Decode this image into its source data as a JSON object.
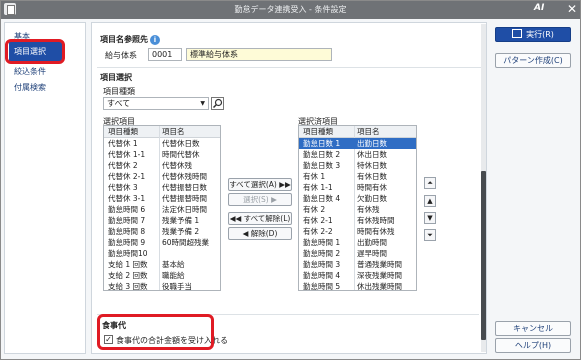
{
  "window": {
    "title": "勤怠データ連携受入 - 条件設定",
    "logo_text": "AI",
    "close_glyph": "✕"
  },
  "nav": {
    "items": [
      "基本",
      "項目選択",
      "絞込条件",
      "付属検索"
    ]
  },
  "ref": {
    "section_title": "項目名参照先",
    "info_glyph": "i",
    "label": "給与体系",
    "code": "0001",
    "name": "標準給与体系"
  },
  "itemsel": {
    "section_title": "項目選択",
    "type_label": "項目種類",
    "type_value": "すべて",
    "avail_label": "選択項目",
    "selected_label": "選択済項目",
    "col_type": "項目種類",
    "col_name": "項目名",
    "available": [
      [
        "代替休 1",
        "代替休日数"
      ],
      [
        "代替休 1-1",
        "時間代替休"
      ],
      [
        "代替休 2",
        "代替休残"
      ],
      [
        "代替休 2-1",
        "代替休残時間"
      ],
      [
        "代替休 3",
        "代替振替日数"
      ],
      [
        "代替休 3-1",
        "代替振替時間"
      ],
      [
        "勤怠時間 6",
        "法定休日時間"
      ],
      [
        "勤怠時間 7",
        "残業予備 1"
      ],
      [
        "勤怠時間 8",
        "残業予備 2"
      ],
      [
        "勤怠時間 9",
        "60時間超残業"
      ],
      [
        "勤怠時間10",
        ""
      ],
      [
        "支給 1 回数",
        "基本給"
      ],
      [
        "支給 2 回数",
        "職能給"
      ],
      [
        "支給 3 回数",
        "役職手当"
      ]
    ],
    "selected": [
      [
        "勤怠日数 1",
        "出勤日数"
      ],
      [
        "勤怠日数 2",
        "休出日数"
      ],
      [
        "勤怠日数 3",
        "特休日数"
      ],
      [
        "有休 1",
        "有休日数"
      ],
      [
        "有休 1-1",
        "時間有休"
      ],
      [
        "勤怠日数 4",
        "欠勤日数"
      ],
      [
        "有休 2",
        "有休残"
      ],
      [
        "有休 2-1",
        "有休残時間"
      ],
      [
        "有休 2-2",
        "時間有休残"
      ],
      [
        "勤怠時間 1",
        "出勤時間"
      ],
      [
        "勤怠時間 2",
        "遅早時間"
      ],
      [
        "勤怠時間 3",
        "普通残業時間"
      ],
      [
        "勤怠時間 4",
        "深夜残業時間"
      ],
      [
        "勤怠時間 5",
        "休出残業時間"
      ]
    ],
    "btn_select_all": "すべて選択(A) ▶▶",
    "btn_select": "選択(S) ▶",
    "btn_unselect_all": "◀◀ すべて解除(L)",
    "btn_unselect": "◀ 解除(D)",
    "order_glyphs": [
      "⏶",
      "▲",
      "▼",
      "⏷"
    ]
  },
  "meal": {
    "section_title": "食事代",
    "checkbox_label": "食事代の合計金額を受け入れる",
    "check_glyph": "✓"
  },
  "actions": {
    "run": "実行(R)",
    "pattern": "パターン作成(C)",
    "cancel": "キャンセル",
    "help": "ヘルプ(H)"
  }
}
